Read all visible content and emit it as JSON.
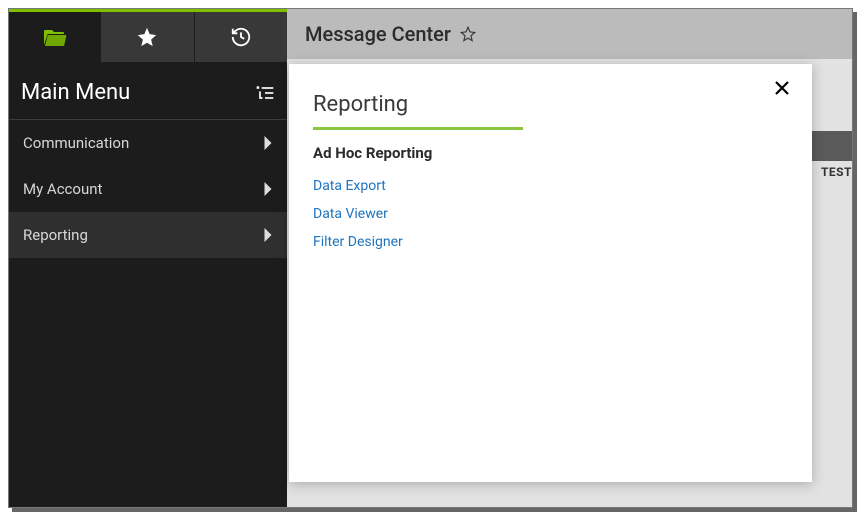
{
  "sidebar": {
    "title": "Main Menu",
    "items": [
      {
        "label": "Communication",
        "active": false
      },
      {
        "label": "My Account",
        "active": false
      },
      {
        "label": "Reporting",
        "active": true
      }
    ]
  },
  "header": {
    "title": "Message Center"
  },
  "popup": {
    "title": "Reporting",
    "category": "Ad Hoc Reporting",
    "links": [
      "Data Export",
      "Data Viewer",
      "Filter Designer"
    ]
  },
  "fragment": "TEST"
}
